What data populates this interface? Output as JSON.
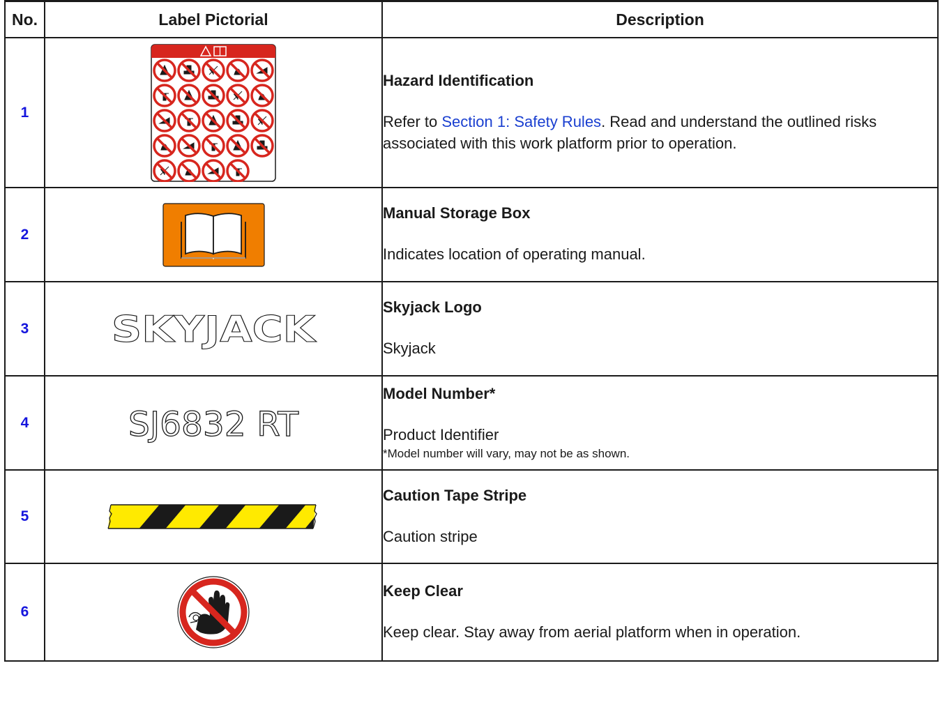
{
  "header": {
    "no": "No.",
    "pictorial": "Label Pictorial",
    "description": "Description"
  },
  "rows": [
    {
      "no": "1",
      "title": "Hazard Identification",
      "body_before_link": "Refer to ",
      "link": "Section 1: Safety Rules",
      "body_after_link": ". Read and understand the outlined risks associated with this work platform prior to operation.",
      "icon": "prohibition-pictograms-label"
    },
    {
      "no": "2",
      "title": "Manual Storage Box",
      "body": "Indicates location of operating manual.",
      "icon": "manual-book-icon"
    },
    {
      "no": "3",
      "title": "Skyjack Logo",
      "body": "Skyjack",
      "logo_text": "SKYJACK",
      "icon": "skyjack-logo"
    },
    {
      "no": "4",
      "title": "Model Number*",
      "body": "Product Identifier",
      "note": "*Model number will vary, may not be as shown.",
      "model_text": "SJ6832 RT",
      "icon": "model-number-decal"
    },
    {
      "no": "5",
      "title": "Caution Tape Stripe",
      "body": "Caution stripe",
      "icon": "caution-stripe"
    },
    {
      "no": "6",
      "title": "Keep Clear",
      "body": "Keep clear. Stay away from aerial platform when in operation.",
      "icon": "keep-clear-hand-icon"
    }
  ],
  "colors": {
    "link": "#1a3fd0",
    "row_number": "#1515dd",
    "hazard_red": "#d7261e",
    "orange": "#f07e00",
    "caution_yellow": "#ffea00"
  }
}
